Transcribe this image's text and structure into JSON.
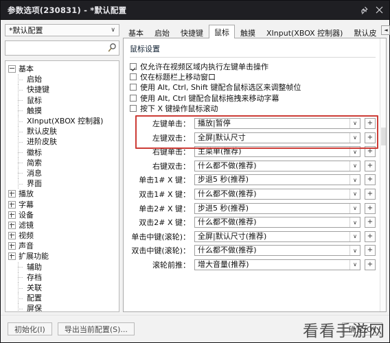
{
  "window": {
    "title": "参数选项(230831) - *默认配置",
    "pin_icon": "pin-icon",
    "close_icon": "close-icon"
  },
  "sidebar": {
    "profile": {
      "value": "*默认配置",
      "caret": "∨"
    },
    "search": {
      "value": "",
      "placeholder": "",
      "icon": "search-icon"
    },
    "tree": [
      {
        "label": "基本",
        "level": 0,
        "expander": "minus"
      },
      {
        "label": "启始",
        "level": 1,
        "expander": "none"
      },
      {
        "label": "快捷键",
        "level": 1,
        "expander": "none"
      },
      {
        "label": "鼠标",
        "level": 1,
        "expander": "none"
      },
      {
        "label": "触摸",
        "level": 1,
        "expander": "none"
      },
      {
        "label": "XInput(XBOX 控制器)",
        "level": 1,
        "expander": "none"
      },
      {
        "label": "默认皮肤",
        "level": 1,
        "expander": "none"
      },
      {
        "label": "进阶皮肤",
        "level": 1,
        "expander": "none"
      },
      {
        "label": "徽标",
        "level": 1,
        "expander": "none"
      },
      {
        "label": "简索",
        "level": 1,
        "expander": "none"
      },
      {
        "label": "消息",
        "level": 1,
        "expander": "none"
      },
      {
        "label": "界面",
        "level": 1,
        "expander": "none"
      },
      {
        "label": "播放",
        "level": 0,
        "expander": "plus"
      },
      {
        "label": "字幕",
        "level": 0,
        "expander": "plus"
      },
      {
        "label": "设备",
        "level": 0,
        "expander": "plus"
      },
      {
        "label": "滤镜",
        "level": 0,
        "expander": "plus"
      },
      {
        "label": "视频",
        "level": 0,
        "expander": "plus"
      },
      {
        "label": "声音",
        "level": 0,
        "expander": "plus"
      },
      {
        "label": "扩展功能",
        "level": 0,
        "expander": "plus"
      },
      {
        "label": "辅助",
        "level": 1,
        "expander": "none"
      },
      {
        "label": "存档",
        "level": 1,
        "expander": "none"
      },
      {
        "label": "关联",
        "level": 1,
        "expander": "none"
      },
      {
        "label": "配置",
        "level": 1,
        "expander": "none"
      },
      {
        "label": "屏保",
        "level": 1,
        "expander": "none"
      }
    ]
  },
  "tabs": {
    "items": [
      {
        "label": "基本",
        "active": false
      },
      {
        "label": "启始",
        "active": false
      },
      {
        "label": "快捷键",
        "active": false
      },
      {
        "label": "鼠标",
        "active": true
      },
      {
        "label": "触摸",
        "active": false
      },
      {
        "label": "XInput(XBOX 控制器)",
        "active": false
      },
      {
        "label": "默认皮",
        "active": false
      }
    ],
    "scroll_left": "◄",
    "scroll_right": "►"
  },
  "main": {
    "group_title": "鼠标设置",
    "checkboxes": [
      {
        "label": "仅允许在视频区域内执行左键单击操作",
        "checked": true
      },
      {
        "label": "仅在标题栏上移动窗口",
        "checked": false
      },
      {
        "label": "使用 Alt, Ctrl, Shift 键配合鼠标选区来调整帧位",
        "checked": false
      },
      {
        "label": "使用 Alt, Ctrl 键配合鼠标拖拽来移动字幕",
        "checked": false
      },
      {
        "label": "按下 X 键操作鼠标滚动",
        "checked": false
      }
    ],
    "rows": [
      {
        "label": "左键单击：",
        "value": "播放|暂停",
        "caret": "∨",
        "plus": "+",
        "highlight": true
      },
      {
        "label": "左键双击：",
        "value": "全屏|默认尺寸",
        "caret": "∨",
        "plus": "+",
        "highlight": true
      },
      {
        "label": "右键单击：",
        "value": "主菜单(推荐)",
        "caret": "∨",
        "plus": "+",
        "highlight": false
      },
      {
        "label": "右键双击：",
        "value": "什么都不做(推荐)",
        "caret": "∨",
        "plus": "+",
        "highlight": false
      },
      {
        "label": "单击1# X 键：",
        "value": "步退5 秒(推荐)",
        "caret": "∨",
        "plus": "+",
        "highlight": false
      },
      {
        "label": "双击1# X 键：",
        "value": "什么都不做(推荐)",
        "caret": "∨",
        "plus": "+",
        "highlight": false
      },
      {
        "label": "单击2# X 键：",
        "value": "步进5 秒(推荐)",
        "caret": "∨",
        "plus": "+",
        "highlight": false
      },
      {
        "label": "双击2# X 键：",
        "value": "什么都不做(推荐)",
        "caret": "∨",
        "plus": "+",
        "highlight": false
      },
      {
        "label": "单击中键(滚轮)：",
        "value": "全屏|默认尺寸(推荐)",
        "caret": "∨",
        "plus": "+",
        "highlight": false
      },
      {
        "label": "双击中键(滚轮)：",
        "value": "什么都不做(推荐)",
        "caret": "∨",
        "plus": "+",
        "highlight": false
      },
      {
        "label": "滚轮前推：",
        "value": "增大音量(推荐)",
        "caret": "∨",
        "plus": "+",
        "highlight": false
      }
    ]
  },
  "footer": {
    "init_label": "初始化(I)",
    "export_label": "导出当前配置(S)...",
    "ok_label": "确定(O)",
    "watermark": "看看手游网"
  },
  "colors": {
    "titlebar_bg": "#1f1f23",
    "highlight_red": "#cc3b35",
    "panel_bg": "#ffffff",
    "window_bg": "#f2f2f2"
  }
}
